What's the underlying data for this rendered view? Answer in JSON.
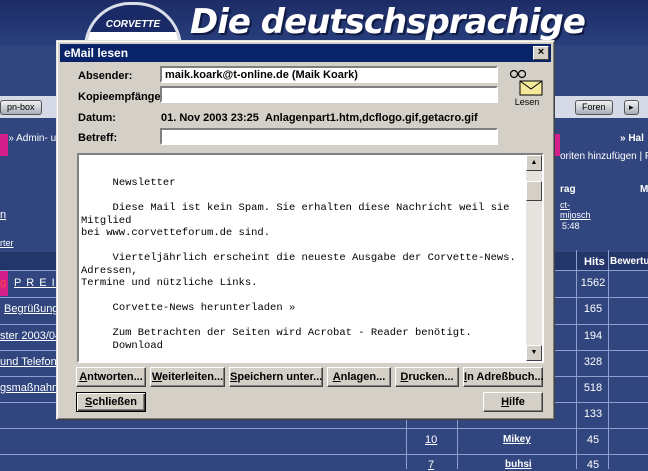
{
  "background": {
    "logo_text": "CORVETTE",
    "headline": "Die deutschsprachige",
    "toolbar_buttons": [
      "pn-box",
      "Foren"
    ],
    "breadcrumb": "n » Admin- u",
    "right_crumb": "» Hal",
    "favorites_text": "oriten hinzufügen | Foru",
    "col_frag": "rag",
    "col_m": "M",
    "user_snippet": "ct-\nmijosch",
    "time_snippet": "5:48",
    "link_n": "n",
    "link_experte": "rter",
    "header_hits": "Hits",
    "header_rating": "Bewertun",
    "rows": [
      {
        "title": "P R E I S",
        "prefix": "g",
        "hits": "1562"
      },
      {
        "title": "Begrüßung",
        "prefix": "",
        "hits": "165"
      },
      {
        "title": "ster 2003/04",
        "prefix": "",
        "hits": "194"
      },
      {
        "title": "und Telefonn",
        "prefix": "",
        "hits": "328"
      },
      {
        "title": "gsmaßnahmen",
        "prefix": "",
        "hits": "518"
      },
      {
        "title": "",
        "prefix": "",
        "hits": "133"
      },
      {
        "title": "",
        "prefix": "",
        "hits": "45",
        "replies": "10",
        "user": "Mikey"
      },
      {
        "title": "",
        "prefix": "",
        "hits": "45",
        "replies": "7",
        "user": "buhsi"
      }
    ]
  },
  "dialog": {
    "title": "eMail lesen",
    "close_glyph": "×",
    "labels": {
      "sender": "Absender:",
      "cc": "Kopieempfänger:",
      "date": "Datum:",
      "attachments": "Anlagen:",
      "subject": "Betreff:"
    },
    "sender_value": "maik.koark@t-online.de (Maik Koark)",
    "cc_value": "",
    "date_value": "01. Nov 2003 23:25",
    "attachments_value": "part1.htm,dcflogo.gif,getacro.gif",
    "subject_value": "",
    "read_icon_label": "Lesen",
    "body_text": "     Newsletter\n\n     Diese Mail ist kein Spam. Sie erhalten diese Nachricht weil sie Mitglied\nbei www.corvetteforum.de sind.\n\n     Vierteljährlich erscheint die neueste Ausgabe der Corvette-News. Adressen,\nTermine und nützliche Links.\n\n     Corvette-News herunterladen »\n\n     Zum Betrachten der Seiten wird Acrobat - Reader benötigt.\n     Download",
    "scroll_up": "▲",
    "scroll_down": "▼",
    "buttons": {
      "reply": {
        "mnemonic": "A",
        "rest": "ntworten..."
      },
      "forward": {
        "mnemonic": "W",
        "rest": "eiterleiten..."
      },
      "save": {
        "mnemonic": "S",
        "rest": "peichern unter..."
      },
      "attach": {
        "mnemonic": "A",
        "rest": "nlagen..."
      },
      "print": {
        "mnemonic": "D",
        "rest": "rucken..."
      },
      "addressbook": {
        "mnemonic": "I",
        "rest": "n Adreßbuch..."
      },
      "close": {
        "mnemonic": "S",
        "rest": "chließen"
      },
      "help": {
        "mnemonic": "H",
        "rest": "ilfe"
      }
    }
  }
}
